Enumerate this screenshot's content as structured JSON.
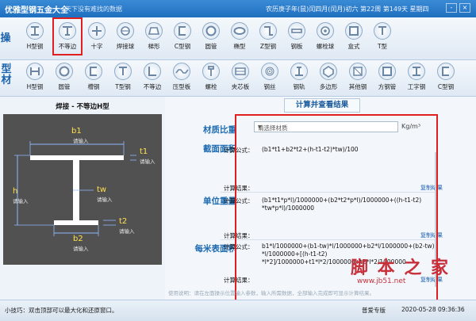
{
  "window": {
    "title": "优雅型钢五金大全",
    "slogan": "天下没有难找的数据",
    "date_info": "农历庚子年(鼠)闰四月(闰月)初六 第22周 第149天 星期四",
    "minimize": "-",
    "close": "×"
  },
  "toolbar1": {
    "label": "操",
    "items": [
      {
        "label": "H型钢",
        "icon": "h-beam-icon"
      },
      {
        "label": "不等边",
        "icon": "unequal-beam-icon"
      },
      {
        "label": "十字",
        "icon": "cross-icon"
      },
      {
        "label": "焊接球",
        "icon": "weld-ball-icon"
      },
      {
        "label": "梯形",
        "icon": "trapezoid-icon"
      },
      {
        "label": "C型钢",
        "icon": "c-steel-icon"
      },
      {
        "label": "圆管",
        "icon": "round-pipe-icon"
      },
      {
        "label": "椭型",
        "icon": "ellipse-icon"
      },
      {
        "label": "Z型钢",
        "icon": "z-steel-icon"
      },
      {
        "label": "钢板",
        "icon": "steel-plate-icon"
      },
      {
        "label": "螺栓球",
        "icon": "bolt-ball-icon"
      },
      {
        "label": "盒式",
        "icon": "box-icon"
      },
      {
        "label": "T型",
        "icon": "t-shape-icon"
      }
    ]
  },
  "toolbar2": {
    "label": "型\n材",
    "items": [
      {
        "label": "H型钢",
        "icon": "h-beam-icon"
      },
      {
        "label": "圆管",
        "icon": "round-pipe-icon"
      },
      {
        "label": "槽钢",
        "icon": "channel-icon"
      },
      {
        "label": "T型钢",
        "icon": "t-steel-icon"
      },
      {
        "label": "不等边",
        "icon": "unequal-angle-icon"
      },
      {
        "label": "压型板",
        "icon": "profiled-sheet-icon"
      },
      {
        "label": "螺栓",
        "icon": "bolt-icon"
      },
      {
        "label": "夹芯板",
        "icon": "sandwich-panel-icon"
      },
      {
        "label": "钢丝",
        "icon": "steel-wire-icon"
      },
      {
        "label": "钢轨",
        "icon": "rail-icon"
      },
      {
        "label": "多边形",
        "icon": "polygon-icon"
      },
      {
        "label": "其他钢",
        "icon": "other-steel-icon"
      },
      {
        "label": "方钢管",
        "icon": "square-pipe-icon"
      },
      {
        "label": "工字钢",
        "icon": "i-beam-icon"
      },
      {
        "label": "C型钢",
        "icon": "c-steel-icon"
      }
    ]
  },
  "left": {
    "title": "焊接 - 不等边H型",
    "dims": {
      "b1": {
        "label": "b1",
        "hint": "请输入"
      },
      "t1": {
        "label": "t1",
        "hint": "请输入"
      },
      "h": {
        "label": "h",
        "hint": "请输入"
      },
      "tw": {
        "label": "tw",
        "hint": "请输入"
      },
      "b2": {
        "label": "b2",
        "hint": "请输入"
      },
      "t2": {
        "label": "t2",
        "hint": "请输入"
      }
    }
  },
  "right": {
    "calc_button": "计算并查看结果",
    "material": {
      "label": "材质比重",
      "placeholder": "请选择材质",
      "unit": "Kg/m³"
    },
    "area": {
      "label": "截面面积",
      "formula_label": "计算公式：",
      "formula": "(b1*t1+b2*t2+(h-t1-t2)*tw)/100",
      "result_label": "计算结果："
    },
    "weight": {
      "label": "单位重量",
      "formula_label": "计算公式：",
      "formula": "(b1*t1*p*l)/1000000+(b2*t2*p*l)/1000000+((h-t1-t2)\n*tw*p*l)/1000000",
      "result_label": "计算结果：",
      "copy": "复制结果"
    },
    "surface": {
      "label": "每米表面积",
      "formula_label": "计算公式：",
      "formula": "b1*l/1000000+(b1-tw)*l/1000000+b2*l/1000000+(b2-tw)\n*l/1000000+[(h-t1-t2)\n*l*2]/1000000+t1*l*2/1000000+t2*l*2/1000000",
      "result_label": "计算结果：",
      "copy": "复制结果"
    },
    "area_copy": "复制结果"
  },
  "watermark": {
    "text": "脚 本 之 家",
    "url": "www.jb51.net"
  },
  "usage_note": "使用说明：请在左面操示位置输入参数，输入所需数据，全部输入完成即可显示计算结果。",
  "status": {
    "tip": "小技巧：双击顶部可以最大化和还原窗口。",
    "edition": "普爱专版",
    "datetime": "2020-05-28 09:36:36"
  }
}
